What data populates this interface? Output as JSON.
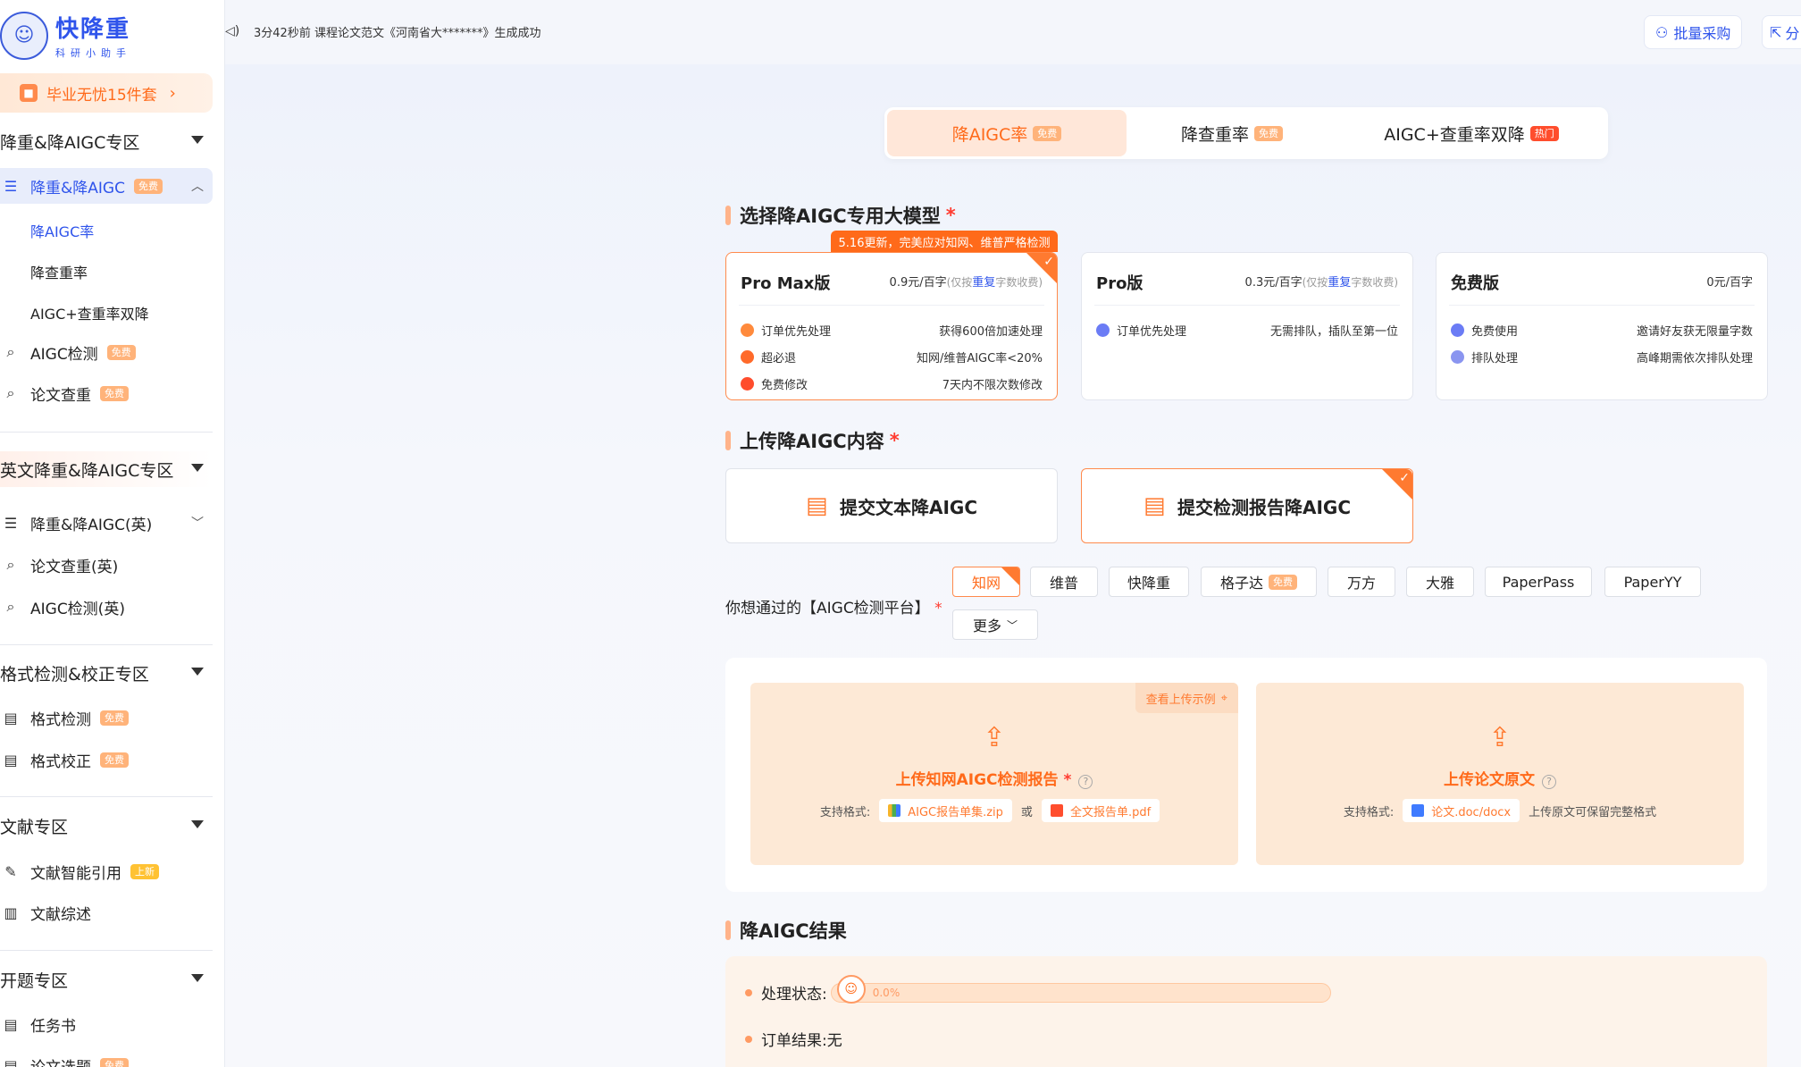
{
  "brand": {
    "title": "快降重",
    "subtitle": "科研小助手"
  },
  "notice": "3分42秒前 课程论文范文《河南省大*******》生成成功",
  "top_buttons": {
    "bulk": "批量采购",
    "share": "分"
  },
  "sidebar": {
    "promo": "毕业无忧15件套",
    "sections": {
      "s1": "降重&降AIGC专区",
      "s2": "英文降重&降AIGC专区",
      "s3": "格式检测&校正专区",
      "s4": "文献专区",
      "s5": "开题专区"
    },
    "items": {
      "reduce_aigc": {
        "label": "降重&降AIGC",
        "badge": "免费"
      },
      "sub_aigc_rate": "降AIGC率",
      "sub_dup_rate": "降查重率",
      "sub_double": "AIGC+查重率双降",
      "aigc_detect": {
        "label": "AIGC检测",
        "badge": "免费"
      },
      "paper_check": {
        "label": "论文查重",
        "badge": "免费"
      },
      "en_reduce": {
        "label": "降重&降AIGC(英)"
      },
      "en_check": {
        "label": "论文查重(英)"
      },
      "en_aigc": {
        "label": "AIGC检测(英)"
      },
      "format_check": {
        "label": "格式检测",
        "badge": "免费"
      },
      "format_fix": {
        "label": "格式校正",
        "badge": "免费"
      },
      "cite": {
        "label": "文献智能引用",
        "badge": "上新"
      },
      "review": {
        "label": "文献综述"
      },
      "task": {
        "label": "任务书"
      },
      "topic": {
        "label": "论文选题",
        "badge": "免费"
      }
    }
  },
  "tabs": [
    {
      "label": "降AIGC率",
      "badge": "免费"
    },
    {
      "label": "降查重率",
      "badge": "免费"
    },
    {
      "label": "AIGC+查重率双降",
      "badge": "热门"
    }
  ],
  "model_section": {
    "title": "选择降AIGC专用大模型",
    "star": "*"
  },
  "ribbon": "5.16更新，完美应对知网、维普严格检测",
  "cards": [
    {
      "title": "Pro Max版",
      "price": "0.9元/百字",
      "note_pre": "(仅按",
      "note_hl": "重复",
      "note_post": "字数收费)",
      "features": [
        {
          "label": "订单优先处理",
          "value": "获得600倍加速处理",
          "color": "#ff8a3c"
        },
        {
          "label": "超必退",
          "value": "知网/维普AIGC率<20%",
          "color": "#ff6a2a"
        },
        {
          "label": "免费修改",
          "value": "7天内不限次数修改",
          "color": "#ff4d2d"
        }
      ]
    },
    {
      "title": "Pro版",
      "price": "0.3元/百字",
      "note_pre": "(仅按",
      "note_hl": "重复",
      "note_post": "字数收费)",
      "features": [
        {
          "label": "订单优先处理",
          "value": "无需排队，插队至第一位",
          "color": "#6b7cf5"
        }
      ]
    },
    {
      "title": "免费版",
      "price": "0元/百字",
      "features": [
        {
          "label": "免费使用",
          "value": "邀请好友获无限量字数",
          "color": "#6b7cf5"
        },
        {
          "label": "排队处理",
          "value": "高峰期需依次排队处理",
          "color": "#8a95f0"
        }
      ]
    }
  ],
  "upload_section": {
    "title": "上传降AIGC内容",
    "star": "*"
  },
  "upload_modes": {
    "text": "提交文本降AIGC",
    "report": "提交检测报告降AIGC"
  },
  "platform": {
    "label": "你想通过的【AIGC检测平台】",
    "star": "*",
    "options": [
      "知网",
      "维普",
      "快降重",
      "格子达",
      "万方",
      "大雅",
      "PaperPass",
      "PaperYY"
    ],
    "badge": "免费",
    "more": "更多"
  },
  "upload_area": {
    "example": "查看上传示例",
    "report": {
      "title": "上传知网AIGC检测报告",
      "star": "*",
      "support": "支持格式:",
      "file1": "AIGC报告单集.zip",
      "or": "或",
      "file2": "全文报告单.pdf"
    },
    "paper": {
      "title": "上传论文原文",
      "support": "支持格式:",
      "file": "论文.doc/docx",
      "tip": "上传原文可保留完整格式"
    }
  },
  "result_section": {
    "title": "降AIGC结果"
  },
  "result": {
    "status_label": "处理状态:",
    "progress": "0.0%",
    "order_label": "订单结果:",
    "order_value": "无"
  }
}
